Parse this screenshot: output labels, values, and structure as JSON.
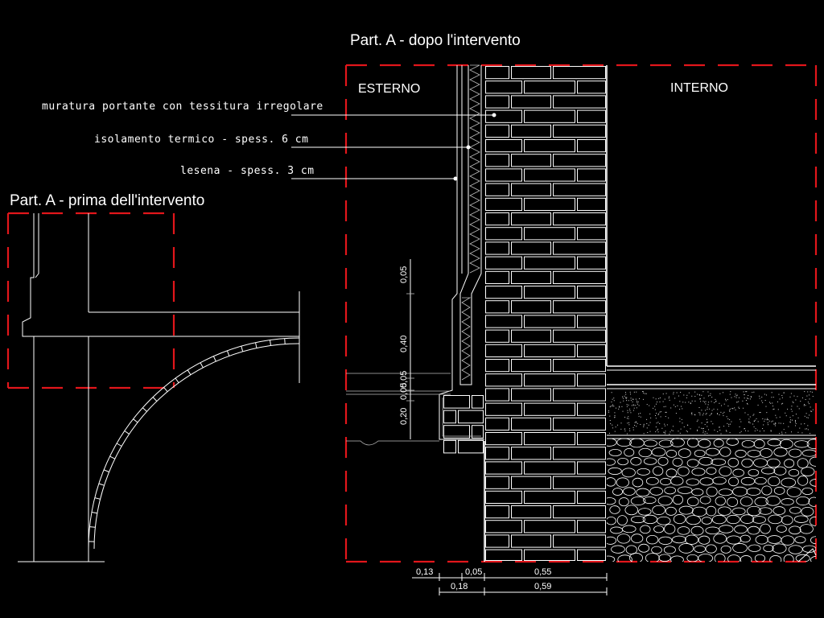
{
  "titles": {
    "after": "Part. A - dopo l'intervento",
    "before": "Part. A - prima dell'intervento"
  },
  "zones": {
    "outside": "ESTERNO",
    "inside": "INTERNO"
  },
  "leaders": [
    "muratura portante con tessitura irregolare",
    "isolamento termico - spess. 6 cm",
    "lesena - spess. 3 cm"
  ],
  "vertical_dims": [
    "0,05",
    "0,40",
    "0,05",
    "0,05",
    "0,20"
  ],
  "bottom_dims": {
    "row1": [
      "0,13",
      "0,05",
      "0,55"
    ],
    "row2": [
      "0,18",
      "0,59"
    ]
  },
  "colors": {
    "background": "#000000",
    "line": "#ffffff",
    "section_boundary": "#e2161b"
  }
}
